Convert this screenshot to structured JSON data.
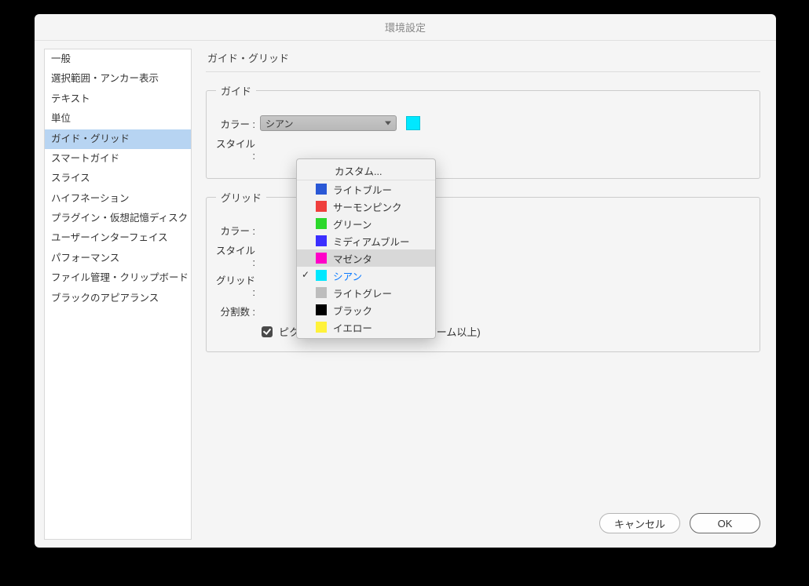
{
  "window": {
    "title": "環境設定"
  },
  "sidebar": {
    "items": [
      {
        "label": "一般"
      },
      {
        "label": "選択範囲・アンカー表示"
      },
      {
        "label": "テキスト"
      },
      {
        "label": "単位"
      },
      {
        "label": "ガイド・グリッド",
        "selected": true
      },
      {
        "label": "スマートガイド"
      },
      {
        "label": "スライス"
      },
      {
        "label": "ハイフネーション"
      },
      {
        "label": "プラグイン・仮想記憶ディスク"
      },
      {
        "label": "ユーザーインターフェイス"
      },
      {
        "label": "パフォーマンス"
      },
      {
        "label": "ファイル管理・クリップボード"
      },
      {
        "label": "ブラックのアピアランス"
      }
    ]
  },
  "page": {
    "title": "ガイド・グリッド"
  },
  "groups": {
    "guide": {
      "legend": "ガイド",
      "color_label": "カラー :",
      "color_value": "シアン",
      "style_label": "スタイル :",
      "swatch": "#00e8ff"
    },
    "grid": {
      "legend": "グリッド",
      "color_label": "カラー :",
      "style_label": "スタイル :",
      "spacing_label": "グリッド :",
      "subdiv_label": "分割数 :",
      "swatch": "#c4c4c4",
      "checkbox_label": "ピクセルグリッドを表示 (600% ズーム以上)",
      "checkbox_checked": true
    }
  },
  "dropdown": {
    "custom": "カスタム...",
    "options": [
      {
        "label": "ライトブルー",
        "color": "#2a58d6"
      },
      {
        "label": "サーモンピンク",
        "color": "#ef3f3d"
      },
      {
        "label": "グリーン",
        "color": "#2bd82b"
      },
      {
        "label": "ミディアムブルー",
        "color": "#3b2fff"
      },
      {
        "label": "マゼンタ",
        "color": "#ff00c8",
        "highlight": true
      },
      {
        "label": "シアン",
        "color": "#00e8ff",
        "current": true,
        "checked": true
      },
      {
        "label": "ライトグレー",
        "color": "#bdbdbd"
      },
      {
        "label": "ブラック",
        "color": "#000000"
      },
      {
        "label": "イエロー",
        "color": "#fff23a"
      }
    ]
  },
  "footer": {
    "cancel": "キャンセル",
    "ok": "OK"
  }
}
